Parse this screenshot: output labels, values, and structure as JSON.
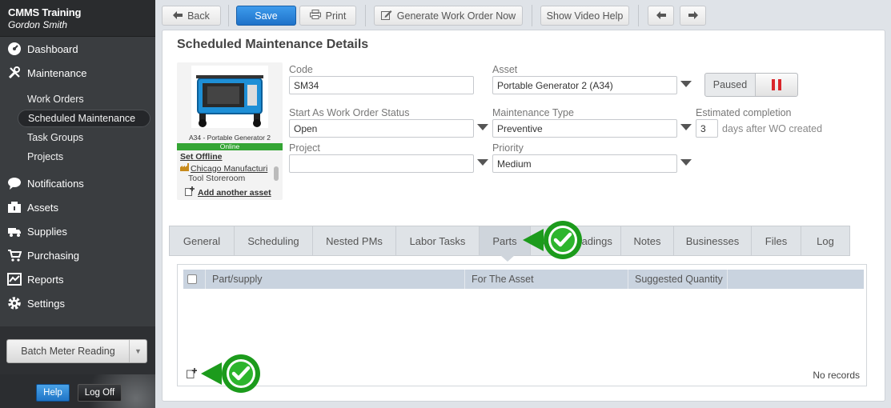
{
  "sidebar": {
    "app_title": "CMMS Training",
    "user_name": "Gordon Smith",
    "nav": {
      "dashboard": "Dashboard",
      "maintenance": "Maintenance",
      "work_orders": "Work Orders",
      "scheduled_maintenance": "Scheduled Maintenance",
      "task_groups": "Task Groups",
      "projects": "Projects",
      "notifications": "Notifications",
      "assets": "Assets",
      "supplies": "Supplies",
      "purchasing": "Purchasing",
      "reports": "Reports",
      "settings": "Settings"
    },
    "batch_meter_label": "Batch Meter Reading",
    "help_label": "Help",
    "logoff_label": "Log Off"
  },
  "toolbar": {
    "back_label": "Back",
    "save_label": "Save",
    "print_label": "Print",
    "generate_label": "Generate Work Order Now",
    "video_help_label": "Show Video Help"
  },
  "details": {
    "title": "Scheduled Maintenance Details",
    "asset_card": {
      "caption": "A34 - Portable Generator 2",
      "status": "Online",
      "set_offline": "Set Offline",
      "location": "Chicago Manufacturi",
      "storeroom": "Tool Storeroom",
      "add_asset": "Add another asset"
    },
    "fields": {
      "code_label": "Code",
      "code_value": "SM34",
      "asset_label": "Asset",
      "asset_value": "Portable Generator 2 (A34)",
      "status_label": "Start As Work Order Status",
      "status_value": "Open",
      "maint_type_label": "Maintenance Type",
      "maint_type_value": "Preventive",
      "est_label": "Estimated completion",
      "est_value": "3",
      "est_suffix": "days after WO created",
      "project_label": "Project",
      "project_value": "",
      "priority_label": "Priority",
      "priority_value": "Medium"
    },
    "paused_label": "Paused",
    "tabs": [
      "General",
      "Scheduling",
      "Nested PMs",
      "Labor Tasks",
      "Parts",
      "Meter Readings",
      "Notes",
      "Businesses",
      "Files",
      "Log"
    ],
    "active_tab": "Parts",
    "parts_grid": {
      "columns": [
        "Part/supply",
        "For The Asset",
        "Suggested Quantity"
      ],
      "empty_text": "No records"
    }
  },
  "colors": {
    "sidebar_bg": "#3a3d40",
    "primary_button": "#2a84d8",
    "online_green": "#34a534",
    "pause_red": "#d9262b",
    "badge_green": "#2db52d"
  }
}
